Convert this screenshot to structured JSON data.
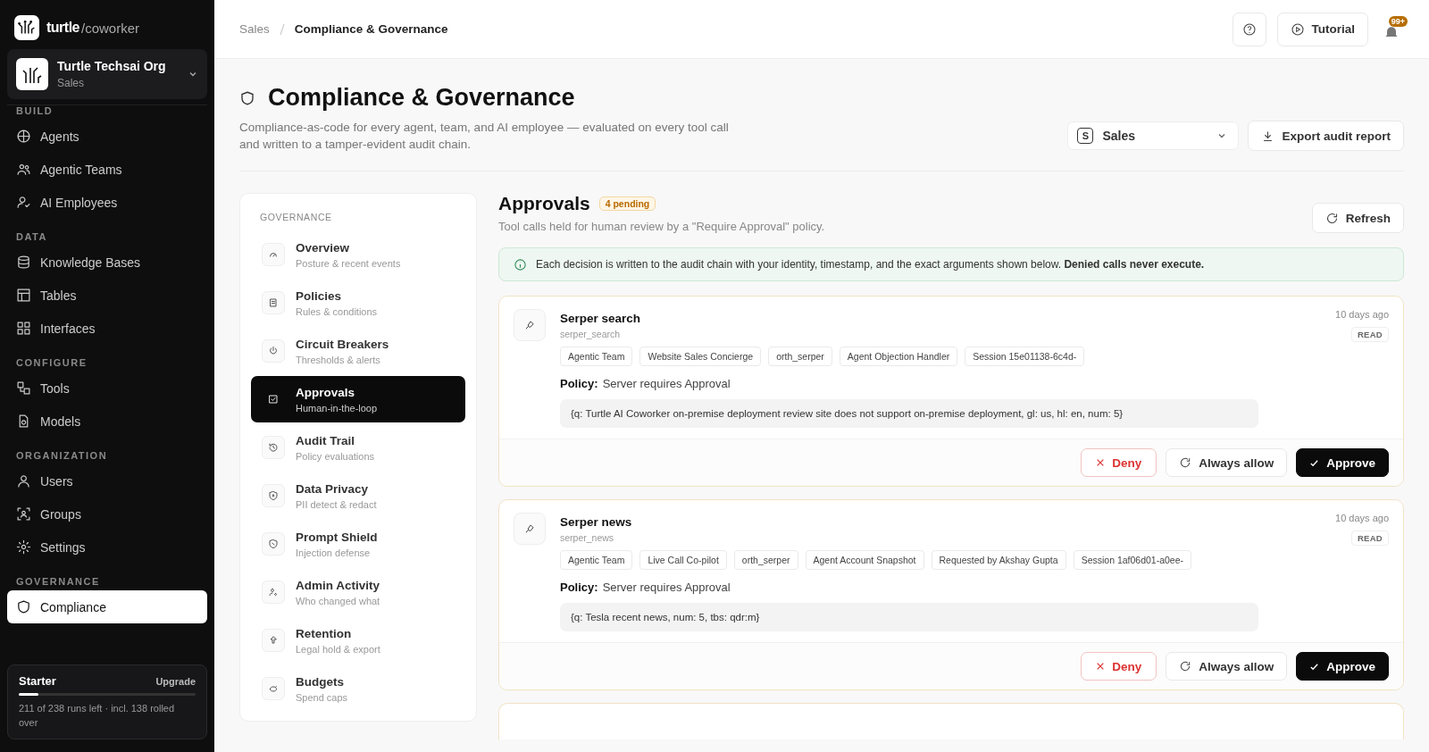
{
  "brand": {
    "name": "turtle",
    "suffix": "/coworker"
  },
  "org": {
    "name": "Turtle Techsai Org",
    "workspace": "Sales"
  },
  "sidebar": {
    "sections": [
      {
        "heading": "BUILD",
        "items": [
          {
            "label": "Agents",
            "selected": false
          },
          {
            "label": "Agentic Teams",
            "selected": false
          },
          {
            "label": "AI Employees",
            "selected": false
          }
        ]
      },
      {
        "heading": "DATA",
        "items": [
          {
            "label": "Knowledge Bases",
            "selected": false
          },
          {
            "label": "Tables",
            "selected": false
          },
          {
            "label": "Interfaces",
            "selected": false
          }
        ]
      },
      {
        "heading": "CONFIGURE",
        "items": [
          {
            "label": "Tools",
            "selected": false
          },
          {
            "label": "Models",
            "selected": false
          }
        ]
      },
      {
        "heading": "ORGANIZATION",
        "items": [
          {
            "label": "Users",
            "selected": false
          },
          {
            "label": "Groups",
            "selected": false
          },
          {
            "label": "Settings",
            "selected": false
          }
        ]
      },
      {
        "heading": "GOVERNANCE",
        "items": [
          {
            "label": "Compliance",
            "selected": true
          }
        ]
      }
    ]
  },
  "plan": {
    "name": "Starter",
    "action": "Upgrade",
    "level": 0.11,
    "note": "211 of 238 runs left · incl. 138 rolled over"
  },
  "breadcrumb": [
    "Sales",
    "Compliance & Governance"
  ],
  "topbar": {
    "tutorial": "Tutorial",
    "notifications": "99+"
  },
  "header": {
    "title": "Compliance & Governance",
    "description": "Compliance-as-code for every agent, team, and AI employee — evaluated on every tool call and written to a tamper-evident audit chain.",
    "workspace_badge": "S",
    "workspace": "Sales",
    "export": "Export audit report"
  },
  "gov_nav": {
    "heading": "GOVERNANCE",
    "items": [
      {
        "title": "Overview",
        "subtitle": "Posture & recent events",
        "selected": false
      },
      {
        "title": "Policies",
        "subtitle": "Rules & conditions",
        "selected": false
      },
      {
        "title": "Circuit Breakers",
        "subtitle": "Thresholds & alerts",
        "selected": false
      },
      {
        "title": "Approvals",
        "subtitle": "Human-in-the-loop",
        "selected": true
      },
      {
        "title": "Audit Trail",
        "subtitle": "Policy evaluations",
        "selected": false
      },
      {
        "title": "Data Privacy",
        "subtitle": "PII detect & redact",
        "selected": false
      },
      {
        "title": "Prompt Shield",
        "subtitle": "Injection defense",
        "selected": false
      },
      {
        "title": "Admin Activity",
        "subtitle": "Who changed what",
        "selected": false
      },
      {
        "title": "Retention",
        "subtitle": "Legal hold & export",
        "selected": false
      },
      {
        "title": "Budgets",
        "subtitle": "Spend caps",
        "selected": false
      }
    ]
  },
  "approvals": {
    "title": "Approvals",
    "badge": "4 pending",
    "description": "Tool calls held for human review by a \"Require Approval\" policy.",
    "refresh": "Refresh",
    "notice": "Each decision is written to the audit chain with your identity, timestamp, and the exact arguments shown below. **Denied calls never execute.**",
    "cards": [
      {
        "name": "Serper search",
        "tool": "serper_search",
        "time": "10 days ago",
        "access": "READ",
        "tags": [
          "Agentic Team",
          "Website Sales Concierge",
          "orth_serper",
          "Agent Objection Handler",
          "Session 15e01138-6c4d-"
        ],
        "policy_label": "Policy:",
        "policy": "Server requires Approval",
        "args": "{q: Turtle AI Coworker on-premise deployment review site does not support on-premise deployment, gl: us, hl: en, num: 5}",
        "deny": "Deny",
        "always": "Always allow",
        "approve": "Approve"
      },
      {
        "name": "Serper news",
        "tool": "serper_news",
        "time": "10 days ago",
        "access": "READ",
        "tags": [
          "Agentic Team",
          "Live Call Co-pilot",
          "orth_serper",
          "Agent Account Snapshot",
          "Requested by Akshay Gupta",
          "Session 1af06d01-a0ee-"
        ],
        "policy_label": "Policy:",
        "policy": "Server requires Approval",
        "args": "{q: Tesla recent news, num: 5, tbs: qdr:m}",
        "deny": "Deny",
        "always": "Always allow",
        "approve": "Approve"
      }
    ]
  }
}
